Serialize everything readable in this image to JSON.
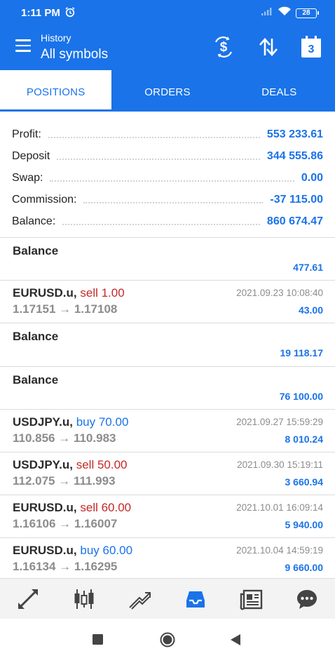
{
  "status": {
    "time": "1:11 PM",
    "battery": "28"
  },
  "appbar": {
    "subtitle": "History",
    "title": "All symbols",
    "calendar_day": "3",
    "icons": [
      "menu-icon",
      "dollar-exchange-icon",
      "sort-icon",
      "calendar-icon"
    ]
  },
  "tabs": [
    {
      "label": "POSITIONS",
      "active": true
    },
    {
      "label": "ORDERS",
      "active": false
    },
    {
      "label": "DEALS",
      "active": false
    }
  ],
  "summary": {
    "profit": {
      "label": "Profit:",
      "value": "553 233.61"
    },
    "deposit": {
      "label": "Deposit",
      "value": "344 555.86"
    },
    "swap": {
      "label": "Swap:",
      "value": "0.00"
    },
    "commission": {
      "label": "Commission:",
      "value": "-37 115.00"
    },
    "balance": {
      "label": "Balance:",
      "value": "860 674.47"
    }
  },
  "items": [
    {
      "symbol": "Balance",
      "profit": "477.61"
    },
    {
      "symbol": "EURUSD.u,",
      "side": "sell 1.00",
      "prices": "1.17151 → 1.17108",
      "date": "2021.09.23 10:08:40",
      "profit": "43.00"
    },
    {
      "symbol": "Balance",
      "profit": "19 118.17"
    },
    {
      "symbol": "Balance",
      "profit": "76 100.00"
    },
    {
      "symbol": "USDJPY.u,",
      "side": "buy 70.00",
      "prices": "110.856 → 110.983",
      "date": "2021.09.27 15:59:29",
      "profit": "8 010.24"
    },
    {
      "symbol": "USDJPY.u,",
      "side": "sell 50.00",
      "prices": "112.075 → 111.993",
      "date": "2021.09.30 15:19:11",
      "profit": "3 660.94"
    },
    {
      "symbol": "EURUSD.u,",
      "side": "sell 60.00",
      "prices": "1.16106 → 1.16007",
      "date": "2021.10.01 16:09:14",
      "profit": "5 940.00"
    },
    {
      "symbol": "EURUSD.u,",
      "side": "buy 60.00",
      "prices": "1.16134 → 1.16295",
      "date": "2021.10.04 14:59:19",
      "profit": "9 660.00"
    }
  ],
  "bottom_nav": [
    "quotes-icon",
    "chart-icon",
    "trade-icon",
    "history-icon",
    "news-icon",
    "chat-icon"
  ],
  "colors": {
    "accent": "#1a73e8",
    "sell": "#c62828",
    "muted": "#8c8c8c"
  }
}
